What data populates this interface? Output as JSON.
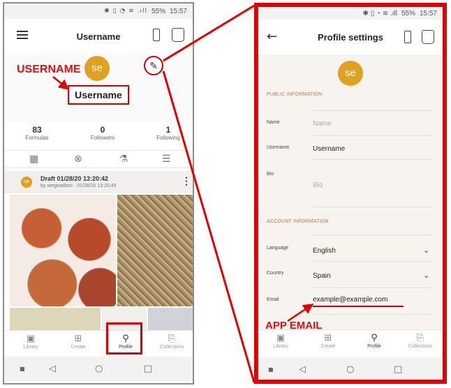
{
  "status": {
    "battery": "55%",
    "time": "15:57",
    "icons": "✱ ▯ ◔ ≋ .ıll"
  },
  "left": {
    "header_title": "Username",
    "avatar_initials": "se",
    "username": "Username",
    "callout": "USERNAME",
    "stats": [
      {
        "value": "83",
        "label": "Formulas"
      },
      {
        "value": "0",
        "label": "Followers"
      },
      {
        "value": "1",
        "label": "Following"
      }
    ],
    "tab_icons": [
      "grid-icon",
      "compass-icon",
      "flask-icon",
      "list-icon"
    ],
    "draft": {
      "avatar": "se",
      "title": "Draft 01/28/20 13:20:42",
      "subtitle": "by sergioalfaro · 01/28/20 13:20:45"
    },
    "nav": [
      {
        "label": "Library",
        "icon": "library-icon"
      },
      {
        "label": "Create",
        "icon": "plus-icon"
      },
      {
        "label": "Profile",
        "icon": "user-icon"
      },
      {
        "label": "Collections",
        "icon": "bookmark-icon"
      }
    ]
  },
  "right": {
    "title": "Profile settings",
    "avatar_initials": "se",
    "public_section": "PUBLIC INFORMATION",
    "account_section": "ACCOUNT INFORMATION",
    "fields": {
      "name_label": "Name",
      "name_placeholder": "Name",
      "username_label": "Username",
      "username_value": "Username",
      "bio_label": "Bio",
      "bio_placeholder": "Bio",
      "language_label": "Language",
      "language_value": "English",
      "country_label": "Country",
      "country_value": "Spain",
      "email_label": "Email",
      "email_value": "example@example.com"
    },
    "callout": "APP EMAIL",
    "nav": [
      {
        "label": "Library"
      },
      {
        "label": "Create"
      },
      {
        "label": "Profile"
      },
      {
        "label": "Collections"
      }
    ]
  },
  "colors": {
    "accent_red": "#e00000",
    "avatar": "#e0a020",
    "section_label": "#b07a50"
  }
}
